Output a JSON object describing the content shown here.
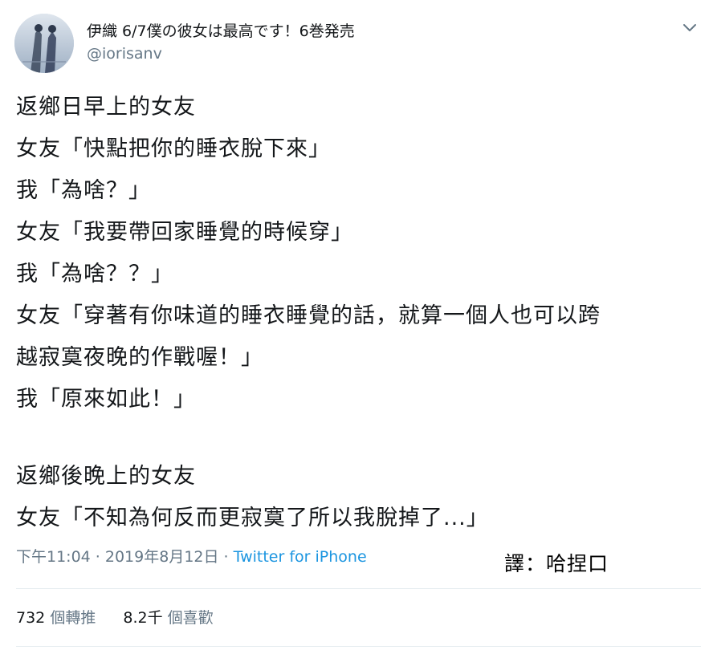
{
  "user": {
    "display_name": "伊織 6/7僕の彼女は最高です！6巻発売",
    "handle": "@iorisanv",
    "avatar_icon": "avatar-image"
  },
  "menu": {
    "icon": "chevron-down-icon"
  },
  "tweet": {
    "lines": [
      "返鄉日早上的女友",
      "女友「快點把你的睡衣脫下來」",
      "我「為啥？」",
      "女友「我要帶回家睡覺的時候穿」",
      "我「為啥？？」",
      "女友「穿著有你味道的睡衣睡覺的話，就算一個人也可以跨",
      "越寂寞夜晚的作戰喔！」",
      "我「原來如此！」",
      "",
      "返鄉後晚上的女友",
      "女友「不知為何反而更寂寞了所以我脫掉了...」"
    ]
  },
  "meta": {
    "timestamp": "下午11:04 · 2019年8月12日",
    "separator": " · ",
    "source": "Twitter for iPhone"
  },
  "translator": "譯：哈捏口",
  "stats": {
    "retweets_count": "732",
    "retweets_label": "個轉推",
    "likes_count": "8.2千",
    "likes_label": "個喜歡"
  },
  "colors": {
    "text": "#14171a",
    "secondary": "#657786",
    "link": "#1b95e0",
    "divider": "#e6ecf0"
  }
}
